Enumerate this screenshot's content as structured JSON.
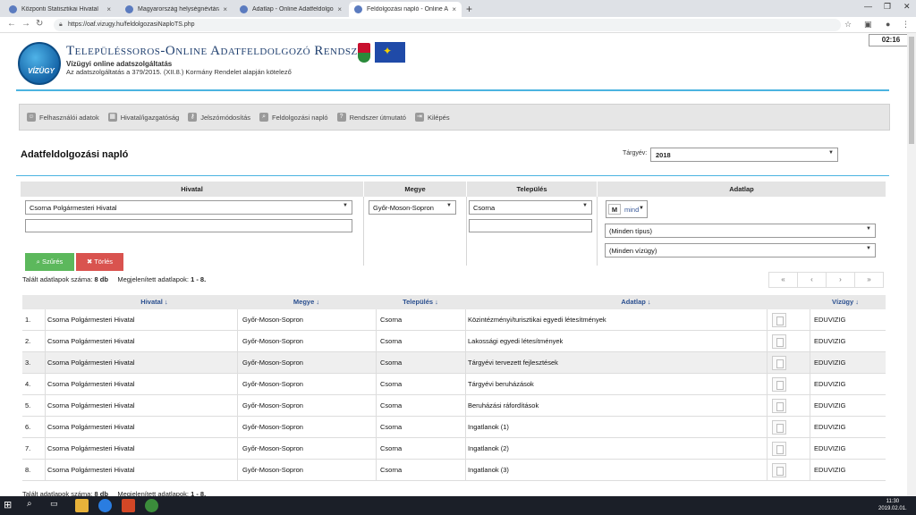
{
  "browser": {
    "tabs": [
      {
        "label": "Központi Statisztikai Hivatal",
        "active": false
      },
      {
        "label": "Magyarország helységnévtára",
        "active": false
      },
      {
        "label": "Adatlap - Online Adatfeldolgozó",
        "active": false
      },
      {
        "label": "Feldolgozási napló - Online Ada",
        "active": true
      }
    ],
    "new_tab": "+",
    "url": "https://oaf.vizugy.hu/feldolgozasiNaploTS.php",
    "clock": "02:16"
  },
  "header": {
    "logo_text": "VÍZÜGY",
    "title": "Településsoros-Online Adatfeldolgozó Rendszer",
    "subtitle1": "Vízügyi online adatszolgáltatás",
    "subtitle2": "Az adatszolgáltatás a 379/2015. (XII.8.) Kormány Rendelet alapján kötelező"
  },
  "menu": [
    {
      "label": "Felhasználói adatok",
      "icon": "user-icon"
    },
    {
      "label": "Hivatal/igazgatóság",
      "icon": "building-icon"
    },
    {
      "label": "Jelszómódosítás",
      "icon": "key-icon"
    },
    {
      "label": "Feldolgozási napló",
      "icon": "search-icon"
    },
    {
      "label": "Rendszer útmutató",
      "icon": "help-icon"
    },
    {
      "label": "Kilépés",
      "icon": "exit-icon"
    }
  ],
  "page": {
    "title": "Adatfeldolgozási napló",
    "year_label": "Tárgyév:",
    "year_value": "2018"
  },
  "filter": {
    "headers": {
      "hivatal": "Hivatal",
      "megye": "Megye",
      "telepules": "Település",
      "adatlap": "Adatlap"
    },
    "hivatal_value": "Csorna Polgármesteri Hivatal",
    "megye_value": "Győr-Moson-Sopron",
    "telepules_value": "Csorna",
    "adatlap_m": "M",
    "adatlap_mind": "mind",
    "tipus_value": "(Minden típus)",
    "vizugy_value": "(Minden vízügy)",
    "search_button": "Szűrés",
    "clear_button": "Törlés"
  },
  "results": {
    "found_label": "Talált adatlapok száma:",
    "found_value": "8 db",
    "shown_label": "Megjelenített adatlapok:",
    "shown_value": "1 - 8.",
    "pager": [
      "«",
      "‹",
      "›",
      "»"
    ]
  },
  "table": {
    "headers": {
      "hivatal": "Hivatal ↓",
      "megye": "Megye ↓",
      "telepules": "Település ↓",
      "adatlap": "Adatlap ↓",
      "vizugy": "Vízügy ↓"
    },
    "rows": [
      {
        "num": "1.",
        "hivatal": "Csorna Polgármesteri Hivatal",
        "megye": "Győr-Moson-Sopron",
        "telepules": "Csorna",
        "adatlap": "Közintézményi/turisztikai egyedi létesítmények",
        "vizugy": "EDUVIZIG"
      },
      {
        "num": "2.",
        "hivatal": "Csorna Polgármesteri Hivatal",
        "megye": "Győr-Moson-Sopron",
        "telepules": "Csorna",
        "adatlap": "Lakossági egyedi létesítmények",
        "vizugy": "EDUVIZIG"
      },
      {
        "num": "3.",
        "hivatal": "Csorna Polgármesteri Hivatal",
        "megye": "Győr-Moson-Sopron",
        "telepules": "Csorna",
        "adatlap": "Tárgyévi tervezett fejlesztések",
        "vizugy": "EDUVIZIG"
      },
      {
        "num": "4.",
        "hivatal": "Csorna Polgármesteri Hivatal",
        "megye": "Győr-Moson-Sopron",
        "telepules": "Csorna",
        "adatlap": "Tárgyévi beruházások",
        "vizugy": "EDUVIZIG"
      },
      {
        "num": "5.",
        "hivatal": "Csorna Polgármesteri Hivatal",
        "megye": "Győr-Moson-Sopron",
        "telepules": "Csorna",
        "adatlap": "Beruházási ráfordítások",
        "vizugy": "EDUVIZIG"
      },
      {
        "num": "6.",
        "hivatal": "Csorna Polgármesteri Hivatal",
        "megye": "Győr-Moson-Sopron",
        "telepules": "Csorna",
        "adatlap": "Ingatlanok (1)",
        "vizugy": "EDUVIZIG"
      },
      {
        "num": "7.",
        "hivatal": "Csorna Polgármesteri Hivatal",
        "megye": "Győr-Moson-Sopron",
        "telepules": "Csorna",
        "adatlap": "Ingatlanok (2)",
        "vizugy": "EDUVIZIG"
      },
      {
        "num": "8.",
        "hivatal": "Csorna Polgármesteri Hivatal",
        "megye": "Győr-Moson-Sopron",
        "telepules": "Csorna",
        "adatlap": "Ingatlanok (3)",
        "vizugy": "EDUVIZIG"
      }
    ]
  },
  "taskbar": {
    "time": "11:30",
    "date": "2019.02.01."
  }
}
